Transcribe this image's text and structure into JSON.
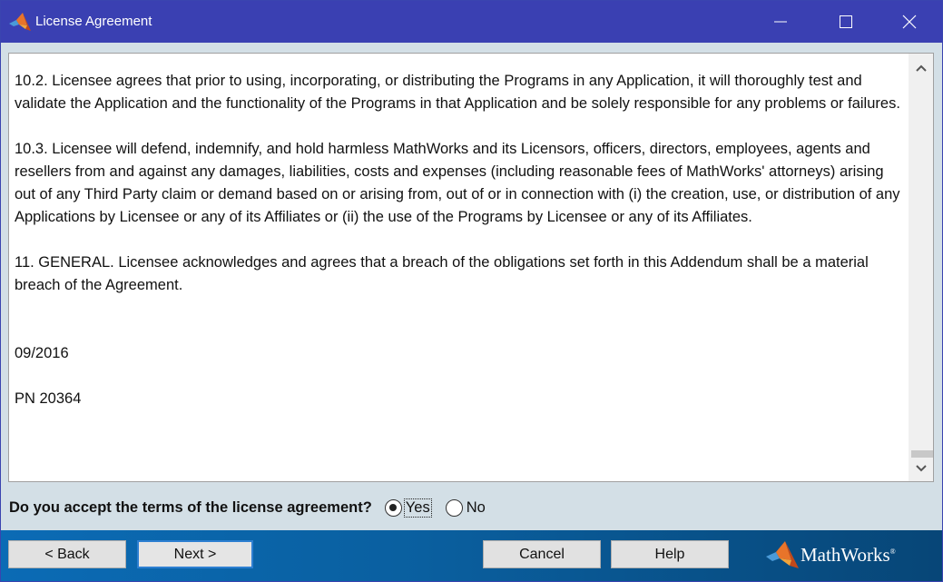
{
  "window": {
    "title": "License Agreement",
    "controls": {
      "minimize": "minimize",
      "maximize": "maximize",
      "close": "close"
    }
  },
  "license": {
    "paragraphs": [
      "10.2. Licensee agrees that prior to using, incorporating, or distributing the Programs in any Application, it will thoroughly test and validate the Application and the functionality of the Programs in that Application and be solely responsible for any problems or failures.",
      "10.3. Licensee will defend, indemnify, and hold harmless MathWorks and its Licensors, officers, directors, employees, agents and resellers from and against any damages, liabilities, costs and expenses (including reasonable fees of MathWorks' attorneys) arising out of any Third Party claim or demand based on or arising from, out of or in connection with (i) the creation, use, or distribution of any Applications by Licensee or any of its Affiliates or (ii) the use of the Programs by Licensee or any of its Affiliates.",
      "11. GENERAL. Licensee acknowledges and agrees that a breach of the obligations set forth in this Addendum shall be a material breach of the Agreement.",
      "09/2016",
      "PN 20364"
    ],
    "scroll_position_percent": 100
  },
  "acceptance": {
    "question": "Do you accept the terms of the license agreement?",
    "options": [
      {
        "label": "Yes",
        "selected": true
      },
      {
        "label": "No",
        "selected": false
      }
    ]
  },
  "footer": {
    "back_label": "< Back",
    "next_label": "Next >",
    "cancel_label": "Cancel",
    "help_label": "Help",
    "brand": "MathWorks",
    "brand_mark": "®"
  },
  "colors": {
    "titlebar": "#3a40b2",
    "footer_start": "#0b6bb5",
    "footer_end": "#074677",
    "dialog_bg": "#d3dfe6"
  }
}
